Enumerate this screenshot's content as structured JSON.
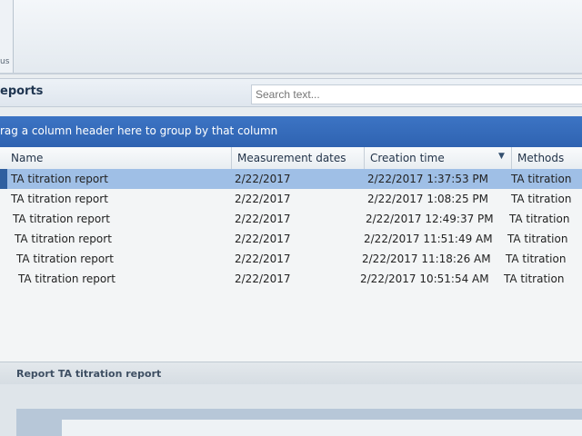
{
  "top": {
    "group_label": "us"
  },
  "reports": {
    "title": "eports",
    "search_placeholder": "Search text..."
  },
  "groupby": {
    "text": "rag a column header here to group by that column"
  },
  "grid": {
    "columns": [
      "Name",
      "Measurement dates",
      "Creation time",
      "Methods"
    ],
    "sort_indicator": "▼",
    "rows": [
      {
        "name": "TA titration report",
        "date": "2/22/2017",
        "created": "2/22/2017 1:37:53 PM",
        "method": "TA titration"
      },
      {
        "name": "TA titration report",
        "date": "2/22/2017",
        "created": "2/22/2017 1:08:25 PM",
        "method": "TA titration"
      },
      {
        "name": "TA titration report",
        "date": "2/22/2017",
        "created": "2/22/2017 12:49:37 PM",
        "method": "TA titration"
      },
      {
        "name": "TA titration report",
        "date": "2/22/2017",
        "created": "2/22/2017 11:51:49 AM",
        "method": "TA titration"
      },
      {
        "name": "TA titration report",
        "date": "2/22/2017",
        "created": "2/22/2017 11:18:26 AM",
        "method": "TA titration"
      },
      {
        "name": "TA titration report",
        "date": "2/22/2017",
        "created": "2/22/2017 10:51:54 AM",
        "method": "TA titration"
      }
    ]
  },
  "footer": {
    "report_label": "Report TA titration report"
  },
  "colors": {
    "groupby_bg": "#2f63b1",
    "selection": "#9fbfe6"
  }
}
